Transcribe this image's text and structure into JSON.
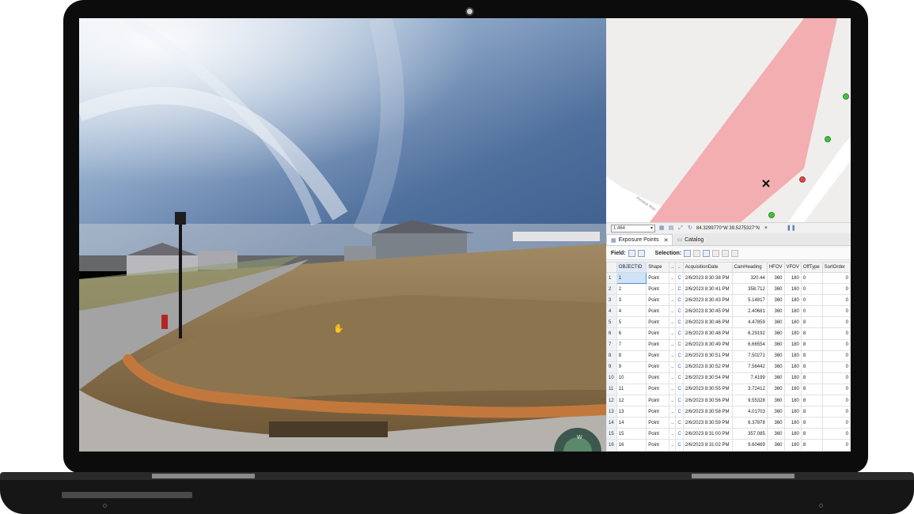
{
  "map": {
    "scale": "1:464",
    "coordinates": "84.3299770°W 39.5275327°N",
    "street_label": "Perlane Way"
  },
  "tabs": [
    {
      "label": "Exposure Points",
      "active": true
    },
    {
      "label": "Catalog",
      "active": false
    }
  ],
  "toolbar": {
    "field_label": "Field:",
    "selection_label": "Selection:"
  },
  "table": {
    "columns": [
      "OBJECTID",
      "Shape",
      "..",
      "..",
      "AcquisitionDate",
      "CamHeading",
      "HFOV",
      "VFOV",
      "OffType",
      "SortOrder"
    ],
    "rows": [
      {
        "n": "1",
        "oid": "1",
        "shape": "Point",
        "a": "..",
        "b": "C",
        "date": "2/6/2023 8:30:38 PM",
        "heading": "320.44",
        "hfov": "360",
        "vfov": "180",
        "off": "0",
        "sort": "0"
      },
      {
        "n": "2",
        "oid": "2",
        "shape": "Point",
        "a": "..",
        "b": "C",
        "date": "2/6/2023 8:30:41 PM",
        "heading": "358.712",
        "hfov": "360",
        "vfov": "180",
        "off": "0",
        "sort": "0"
      },
      {
        "n": "3",
        "oid": "3",
        "shape": "Point",
        "a": "..",
        "b": "C",
        "date": "2/6/2023 8:30:43 PM",
        "heading": "5.14817",
        "hfov": "360",
        "vfov": "180",
        "off": "0",
        "sort": "0"
      },
      {
        "n": "4",
        "oid": "4",
        "shape": "Point",
        "a": "..",
        "b": "C",
        "date": "2/6/2023 8:30:45 PM",
        "heading": "2.40681",
        "hfov": "360",
        "vfov": "180",
        "off": "0",
        "sort": "0"
      },
      {
        "n": "5",
        "oid": "5",
        "shape": "Point",
        "a": "..",
        "b": "C",
        "date": "2/6/2023 8:30:46 PM",
        "heading": "4.47859",
        "hfov": "360",
        "vfov": "180",
        "off": "8",
        "sort": "0"
      },
      {
        "n": "6",
        "oid": "6",
        "shape": "Point",
        "a": "..",
        "b": "C",
        "date": "2/6/2023 8:30:48 PM",
        "heading": "6.29192",
        "hfov": "360",
        "vfov": "180",
        "off": "8",
        "sort": "0"
      },
      {
        "n": "7",
        "oid": "7",
        "shape": "Point",
        "a": "..",
        "b": "C",
        "date": "2/6/2023 8:30:49 PM",
        "heading": "6.66554",
        "hfov": "360",
        "vfov": "180",
        "off": "8",
        "sort": "0"
      },
      {
        "n": "8",
        "oid": "8",
        "shape": "Point",
        "a": "..",
        "b": "C",
        "date": "2/6/2023 8:30:51 PM",
        "heading": "7.50271",
        "hfov": "360",
        "vfov": "180",
        "off": "8",
        "sort": "0"
      },
      {
        "n": "9",
        "oid": "9",
        "shape": "Point",
        "a": "..",
        "b": "C",
        "date": "2/6/2023 8:30:52 PM",
        "heading": "7.56442",
        "hfov": "360",
        "vfov": "180",
        "off": "8",
        "sort": "0"
      },
      {
        "n": "10",
        "oid": "10",
        "shape": "Point",
        "a": "..",
        "b": "C",
        "date": "2/6/2023 8:30:54 PM",
        "heading": "7.4199",
        "hfov": "360",
        "vfov": "180",
        "off": "8",
        "sort": "0"
      },
      {
        "n": "11",
        "oid": "11",
        "shape": "Point",
        "a": "..",
        "b": "C",
        "date": "2/6/2023 8:30:55 PM",
        "heading": "3.72412",
        "hfov": "360",
        "vfov": "180",
        "off": "8",
        "sort": "0"
      },
      {
        "n": "12",
        "oid": "12",
        "shape": "Point",
        "a": "..",
        "b": "C",
        "date": "2/6/2023 8:30:56 PM",
        "heading": "9.55328",
        "hfov": "360",
        "vfov": "180",
        "off": "8",
        "sort": "0"
      },
      {
        "n": "13",
        "oid": "13",
        "shape": "Point",
        "a": "..",
        "b": "C",
        "date": "2/6/2023 8:30:58 PM",
        "heading": "4.01703",
        "hfov": "360",
        "vfov": "180",
        "off": "8",
        "sort": "0"
      },
      {
        "n": "14",
        "oid": "14",
        "shape": "Point",
        "a": "..",
        "b": "C",
        "date": "2/6/2023 8:30:59 PM",
        "heading": "6.37878",
        "hfov": "360",
        "vfov": "180",
        "off": "8",
        "sort": "0"
      },
      {
        "n": "15",
        "oid": "15",
        "shape": "Point",
        "a": "..",
        "b": "C",
        "date": "2/6/2023 8:31:00 PM",
        "heading": "357.085",
        "hfov": "360",
        "vfov": "180",
        "off": "8",
        "sort": "0"
      },
      {
        "n": "16",
        "oid": "16",
        "shape": "Point",
        "a": "..",
        "b": "C",
        "date": "2/6/2023 8:31:02 PM",
        "heading": "9.60469",
        "hfov": "360",
        "vfov": "180",
        "off": "8",
        "sort": "0"
      }
    ]
  },
  "compass": {
    "label": "W"
  },
  "colors": {
    "footprint": "#f2aeb0",
    "point_green": "#3ec43a",
    "point_red": "#e0454b",
    "selection_blue": "#cfe3f7"
  }
}
